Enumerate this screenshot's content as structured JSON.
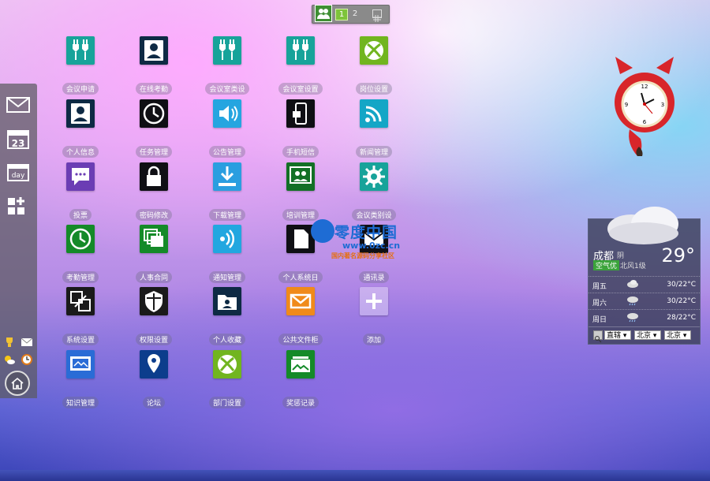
{
  "topbar": {
    "pages": [
      "1",
      "2"
    ],
    "people_icon": "people-icon",
    "grid_icon": "grid-icon"
  },
  "leftbar": {
    "items": [
      {
        "name": "mail-icon"
      },
      {
        "name": "calendar-icon",
        "label": "23"
      },
      {
        "name": "day-icon",
        "label": "day"
      },
      {
        "name": "add-apps-icon"
      }
    ],
    "bottom_icons": [
      "trophy-icon",
      "small-mail-icon",
      "weather-icon",
      "clock-icon"
    ],
    "home_icon": "home-icon"
  },
  "apps": [
    {
      "label": "会议申请",
      "color": "#17a39a",
      "icon": "plug-icon"
    },
    {
      "label": "在线考勤",
      "color": "#0e2a44",
      "icon": "person-icon"
    },
    {
      "label": "会议室类设",
      "color": "#17a39a",
      "icon": "plug-icon"
    },
    {
      "label": "会议室设置",
      "color": "#17a39a",
      "icon": "plug-icon"
    },
    {
      "label": "岗位设置",
      "color": "#71b51f",
      "icon": "xbox-icon"
    },
    {
      "label": "个人信息",
      "color": "#0e2a44",
      "icon": "person-icon"
    },
    {
      "label": "任务管理",
      "color": "#0f0f14",
      "icon": "clock-icon"
    },
    {
      "label": "公告管理",
      "color": "#25a5e0",
      "icon": "speaker-icon"
    },
    {
      "label": "手机短信",
      "color": "#0f0f14",
      "icon": "phone-icon"
    },
    {
      "label": "新闻管理",
      "color": "#14a6c6",
      "icon": "rss-icon"
    },
    {
      "label": "投票",
      "color": "#6b3db4",
      "icon": "chat-icon"
    },
    {
      "label": "密码修改",
      "color": "#0f0f14",
      "icon": "lock-icon"
    },
    {
      "label": "下载管理",
      "color": "#2a9ee0",
      "icon": "download-icon"
    },
    {
      "label": "培训管理",
      "color": "#127026",
      "icon": "group-icon"
    },
    {
      "label": "会议类别设",
      "color": "#17a39a",
      "icon": "gear-icon"
    },
    {
      "label": "考勤管理",
      "color": "#148a28",
      "icon": "clock-icon"
    },
    {
      "label": "人事合同",
      "color": "#148a28",
      "icon": "layers-icon"
    },
    {
      "label": "通知管理",
      "color": "#22a7e0",
      "icon": "wifi-signal-icon"
    },
    {
      "label": "个人系统日",
      "color": "#0f0f14",
      "icon": "doc-icon"
    },
    {
      "label": "通讯录",
      "color": "#0f0f14",
      "icon": "mail-icon"
    },
    {
      "label": "系统设置",
      "color": "#1a1a1a",
      "icon": "swap-icon"
    },
    {
      "label": "权限设置",
      "color": "#1a1a1a",
      "icon": "shield-icon"
    },
    {
      "label": "个人收藏",
      "color": "#0e2a44",
      "icon": "folder-person-icon"
    },
    {
      "label": "公共文件柜",
      "color": "#f08a1a",
      "icon": "envelope-icon"
    },
    {
      "label": "添加",
      "color": "rgba(255,255,255,0.35)",
      "icon": "plus-icon"
    },
    {
      "label": "知识管理",
      "color": "#2a6cd6",
      "icon": "screen-icon"
    },
    {
      "label": "论坛",
      "color": "#0c3d8c",
      "icon": "pin-icon"
    },
    {
      "label": "部门设置",
      "color": "#71b51f",
      "icon": "xbox-icon"
    },
    {
      "label": "奖惩记录",
      "color": "#148a28",
      "icon": "photos-icon"
    }
  ],
  "clock": {
    "label": "fox-clock"
  },
  "weather": {
    "city": "成都",
    "condition": "阴",
    "air_quality": "空气优",
    "wind": "北风1级",
    "temp": "29°",
    "forecast": [
      {
        "day": "周五",
        "temp": "30/22°C",
        "icon": "cloud-icon"
      },
      {
        "day": "周六",
        "temp": "30/22°C",
        "icon": "rain-icon"
      },
      {
        "day": "周日",
        "temp": "28/22°C",
        "icon": "rain-icon"
      }
    ],
    "controls": {
      "search_icon": "search-icon",
      "province": "直辖",
      "city1": "北京",
      "city2": "北京"
    }
  },
  "watermark": {
    "title": "零度中国",
    "url": "www.0zc.cn",
    "slogan": "国内著名源码分享社区"
  }
}
